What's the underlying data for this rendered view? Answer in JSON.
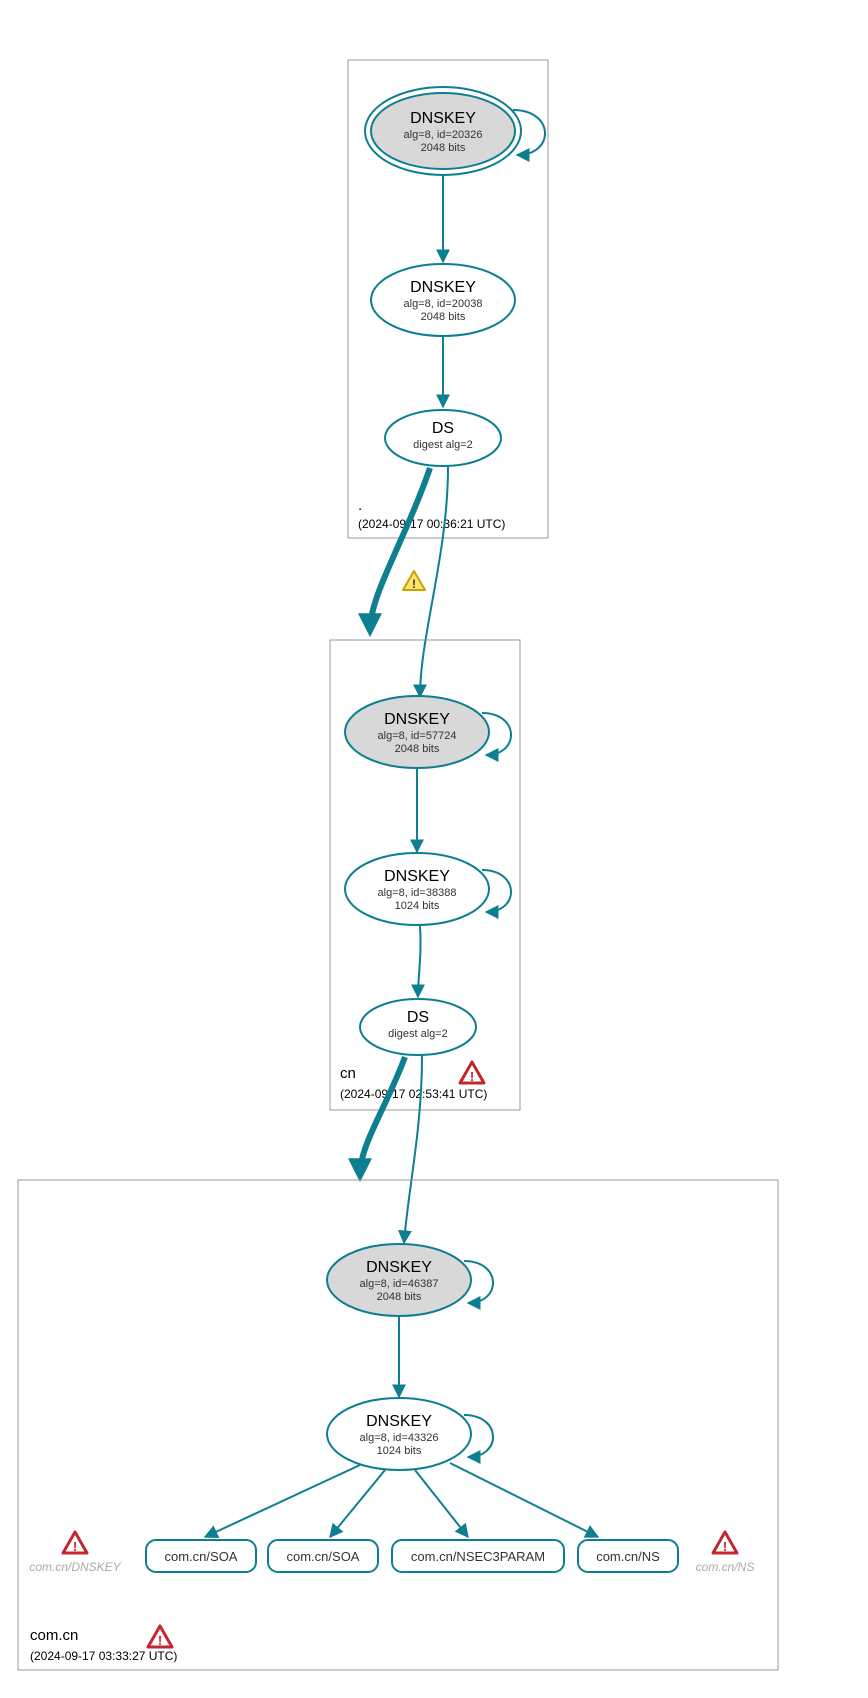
{
  "zones": {
    "root": {
      "label": ".",
      "timestamp": "(2024-09-17 00:36:21 UTC)",
      "dnskey_ksk": {
        "title": "DNSKEY",
        "line1": "alg=8, id=20326",
        "line2": "2048 bits"
      },
      "dnskey_zsk": {
        "title": "DNSKEY",
        "line1": "alg=8, id=20038",
        "line2": "2048 bits"
      },
      "ds": {
        "title": "DS",
        "line1": "digest alg=2"
      }
    },
    "cn": {
      "label": "cn",
      "timestamp": "(2024-09-17 02:53:41 UTC)",
      "dnskey_ksk": {
        "title": "DNSKEY",
        "line1": "alg=8, id=57724",
        "line2": "2048 bits"
      },
      "dnskey_zsk": {
        "title": "DNSKEY",
        "line1": "alg=8, id=38388",
        "line2": "1024 bits"
      },
      "ds": {
        "title": "DS",
        "line1": "digest alg=2"
      }
    },
    "comcn": {
      "label": "com.cn",
      "timestamp": "(2024-09-17 03:33:27 UTC)",
      "dnskey_ksk": {
        "title": "DNSKEY",
        "line1": "alg=8, id=46387",
        "line2": "2048 bits"
      },
      "dnskey_zsk": {
        "title": "DNSKEY",
        "line1": "alg=8, id=43326",
        "line2": "1024 bits"
      },
      "rr1": "com.cn/SOA",
      "rr2": "com.cn/SOA",
      "rr3": "com.cn/NSEC3PARAM",
      "rr4": "com.cn/NS",
      "faded_left": "com.cn/DNSKEY",
      "faded_right": "com.cn/NS"
    }
  }
}
